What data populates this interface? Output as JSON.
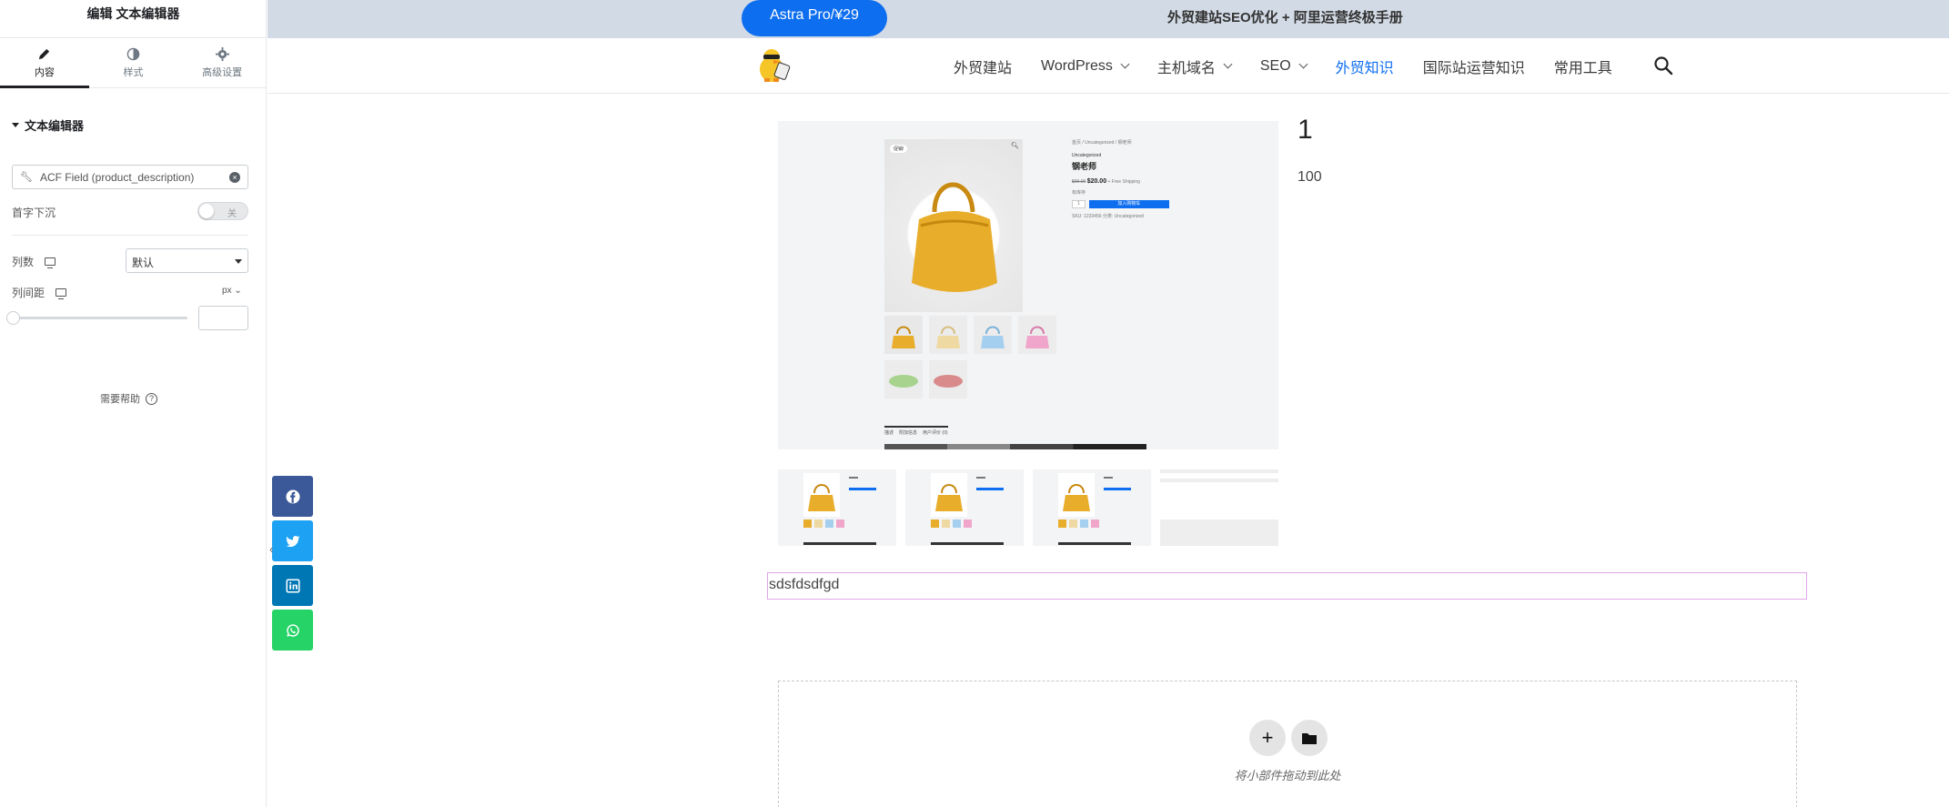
{
  "panel": {
    "header": "编辑 文本编辑器",
    "tabs": [
      {
        "label": "内容",
        "icon": "pencil-icon"
      },
      {
        "label": "样式",
        "icon": "contrast-icon"
      },
      {
        "label": "高级设置",
        "icon": "gear-icon"
      }
    ],
    "section_title": "文本编辑器",
    "dynamic_field": "ACF Field (product_description)",
    "drop_cap_label": "首字下沉",
    "drop_cap_toggle": "关",
    "columns_label": "列数",
    "columns_value": "默认",
    "column_gap_label": "列间距",
    "column_gap_unit": "px",
    "help": "需要帮助"
  },
  "topbar": {
    "pill": "Astra Pro/¥29",
    "promo": "外贸建站SEO优化 +  阿里运营终极手册"
  },
  "nav": {
    "items": [
      {
        "label": "外贸建站",
        "dropdown": false,
        "active": false
      },
      {
        "label": "WordPress",
        "dropdown": true,
        "active": false
      },
      {
        "label": "主机域名",
        "dropdown": true,
        "active": false
      },
      {
        "label": "SEO",
        "dropdown": true,
        "active": false
      },
      {
        "label": "外贸知识",
        "dropdown": false,
        "active": true
      },
      {
        "label": "国际站运营知识",
        "dropdown": false,
        "active": false
      },
      {
        "label": "常用工具",
        "dropdown": false,
        "active": false
      }
    ]
  },
  "product": {
    "title": "1",
    "price": "100",
    "text": "sdsfdsdfgd",
    "mock": {
      "sale_badge": "促销!",
      "breadcrumb": "首页 / Uncategorized / 钢老师",
      "category": "Uncategorized",
      "name": "钢老师",
      "old_price": "$99.00",
      "new_price": "$20.00",
      "shipping": "+ Free Shipping",
      "stock": "有库存",
      "qty": "1",
      "add_to_cart": "加入购物车",
      "meta": "SKU: 1233456   分类: Uncategorized",
      "tabs": [
        "描述",
        "附加信息",
        "用户评价 (0)"
      ]
    }
  },
  "drop_area": {
    "text": "将小部件拖动到此处"
  },
  "social": [
    {
      "name": "facebook",
      "color": "#3b5998"
    },
    {
      "name": "twitter",
      "color": "#1da1f2"
    },
    {
      "name": "linkedin",
      "color": "#0077b5"
    },
    {
      "name": "whatsapp",
      "color": "#25d366"
    }
  ]
}
